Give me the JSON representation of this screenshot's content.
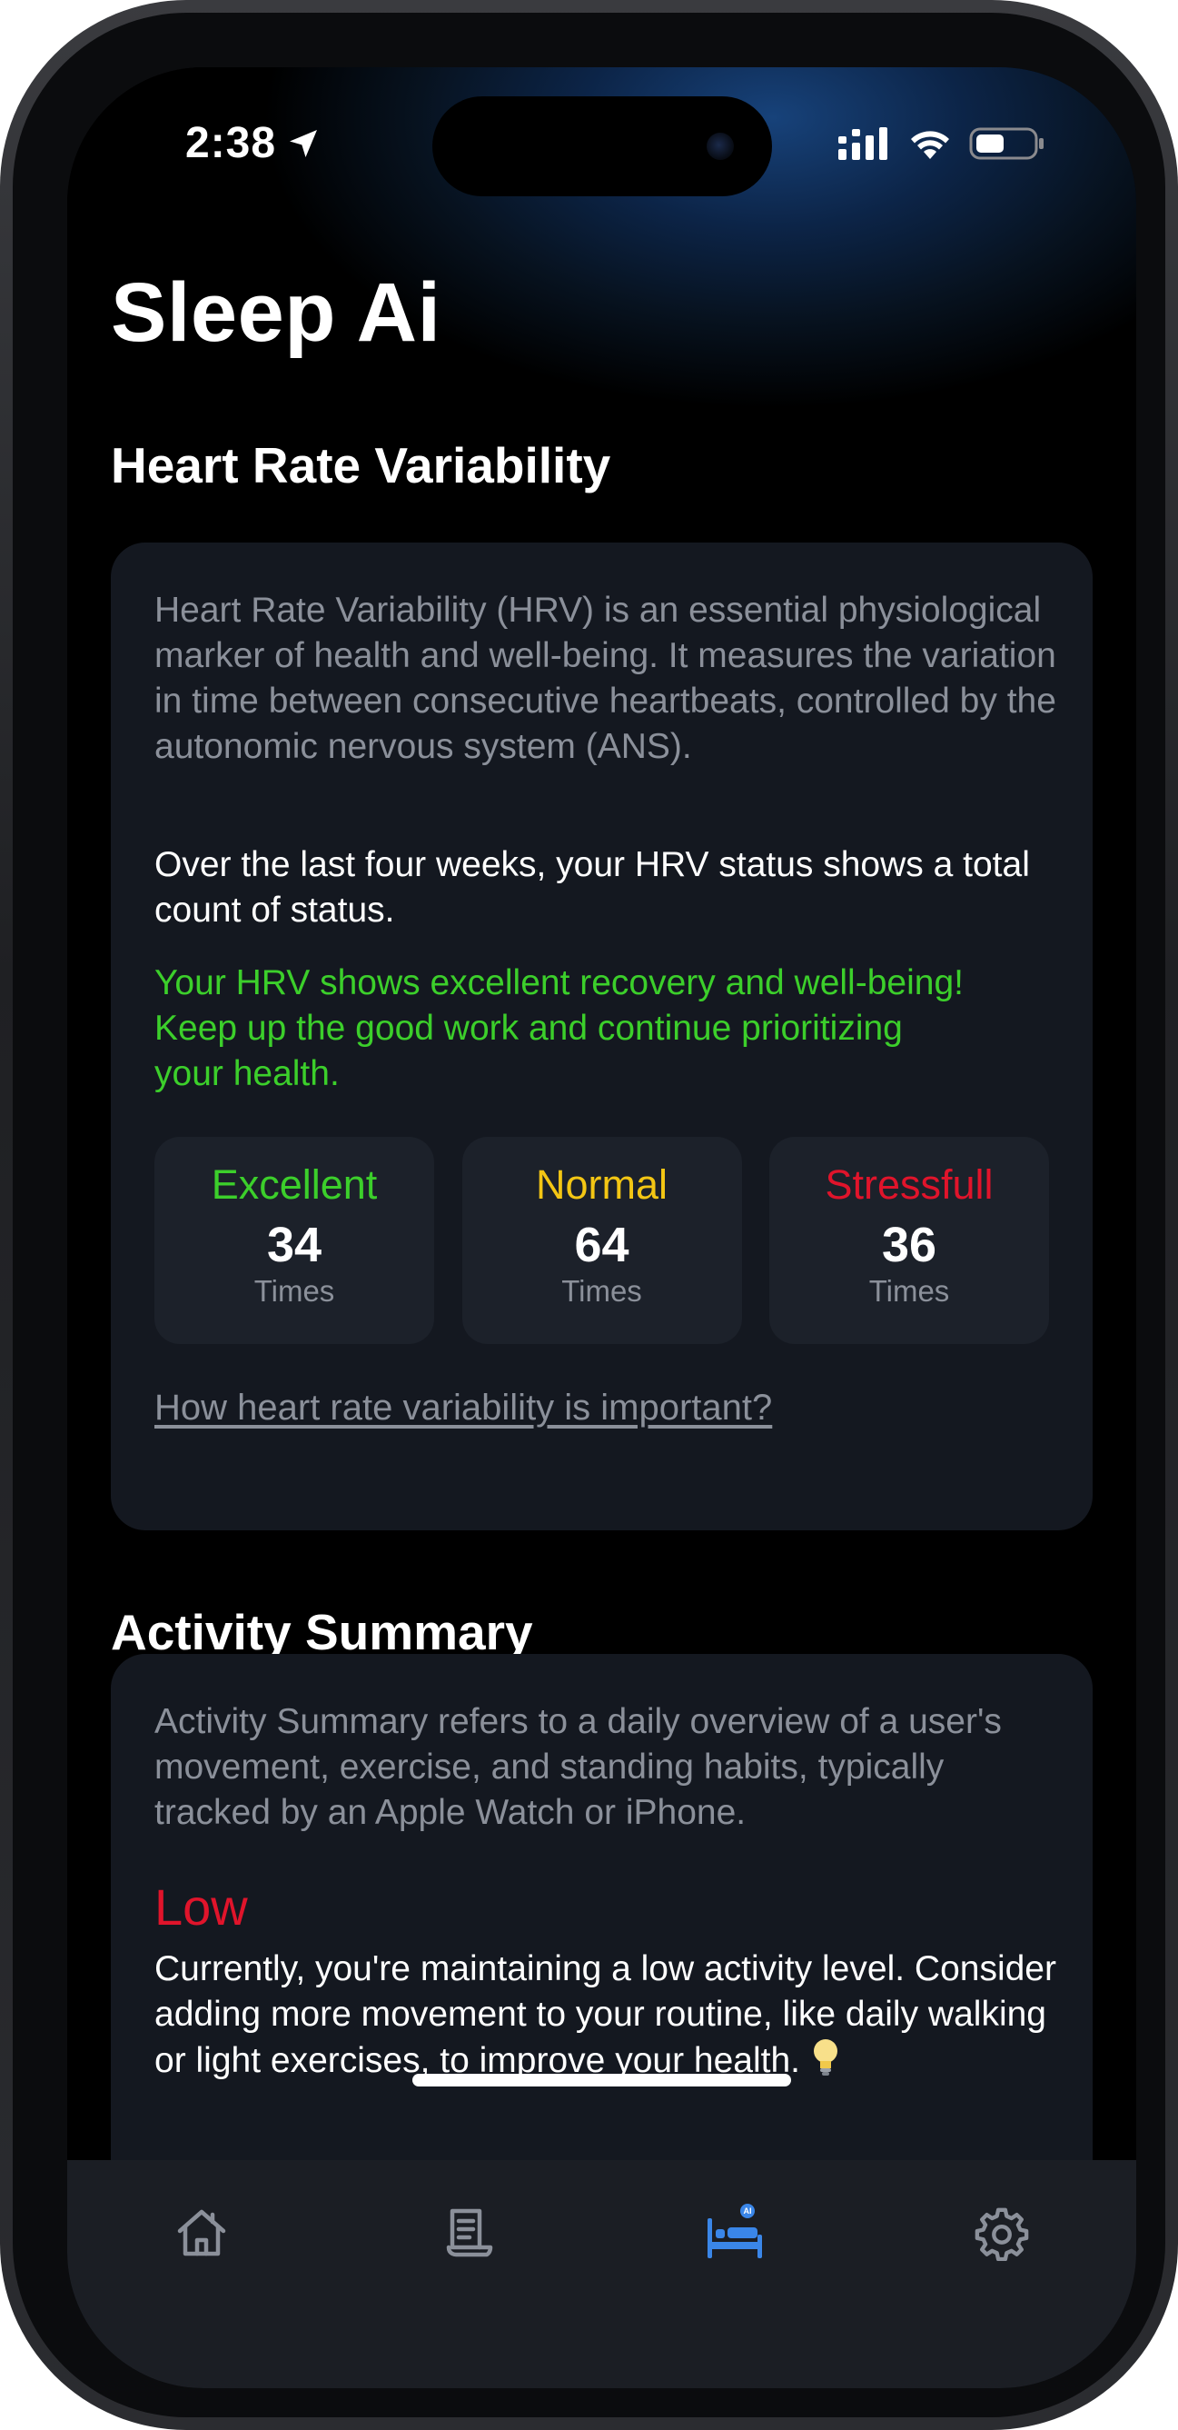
{
  "status_bar": {
    "time": "2:38"
  },
  "app": {
    "title": "Sleep Ai"
  },
  "hrv": {
    "section_title": "Heart Rate Variability",
    "description": "Heart Rate Variability (HRV) is an essential physiological marker of health and well-being. It measures the variation in time between consecutive heartbeats, controlled by the autonomic nervous system (ANS).",
    "summary": "Over the last four weeks, your HRV status shows a total count of status.",
    "feedback": "Your HRV shows excellent recovery and well-being! Keep up the good work and continue prioritizing your health.",
    "stats": [
      {
        "label": "Excellent",
        "value": "34",
        "unit": "Times",
        "color": "#3ccf2b"
      },
      {
        "label": "Normal",
        "value": "64",
        "unit": "Times",
        "color": "#f3c614"
      },
      {
        "label": "Stressfull",
        "value": "36",
        "unit": "Times",
        "color": "#e0142b"
      }
    ],
    "link": "How heart rate variability is important?"
  },
  "activity": {
    "section_title": "Activity Summary",
    "description": "Activity Summary refers to a daily overview of a user's movement, exercise, and standing habits, typically tracked by an Apple Watch or iPhone.",
    "level": "Low",
    "level_color": "#e0142b",
    "advice": "Currently, you're maintaining a low activity level. Consider adding more movement to your routine, like daily walking or light exercises, to improve your health."
  },
  "tabs": [
    {
      "icon": "home-icon",
      "active": false
    },
    {
      "icon": "report-icon",
      "active": false
    },
    {
      "icon": "sleep-ai-bed-icon",
      "active": true,
      "badge": "AI"
    },
    {
      "icon": "gear-icon",
      "active": false
    }
  ],
  "colors": {
    "accent": "#3a86e8",
    "card": "#141820",
    "tabbar": "#1b1e24"
  }
}
